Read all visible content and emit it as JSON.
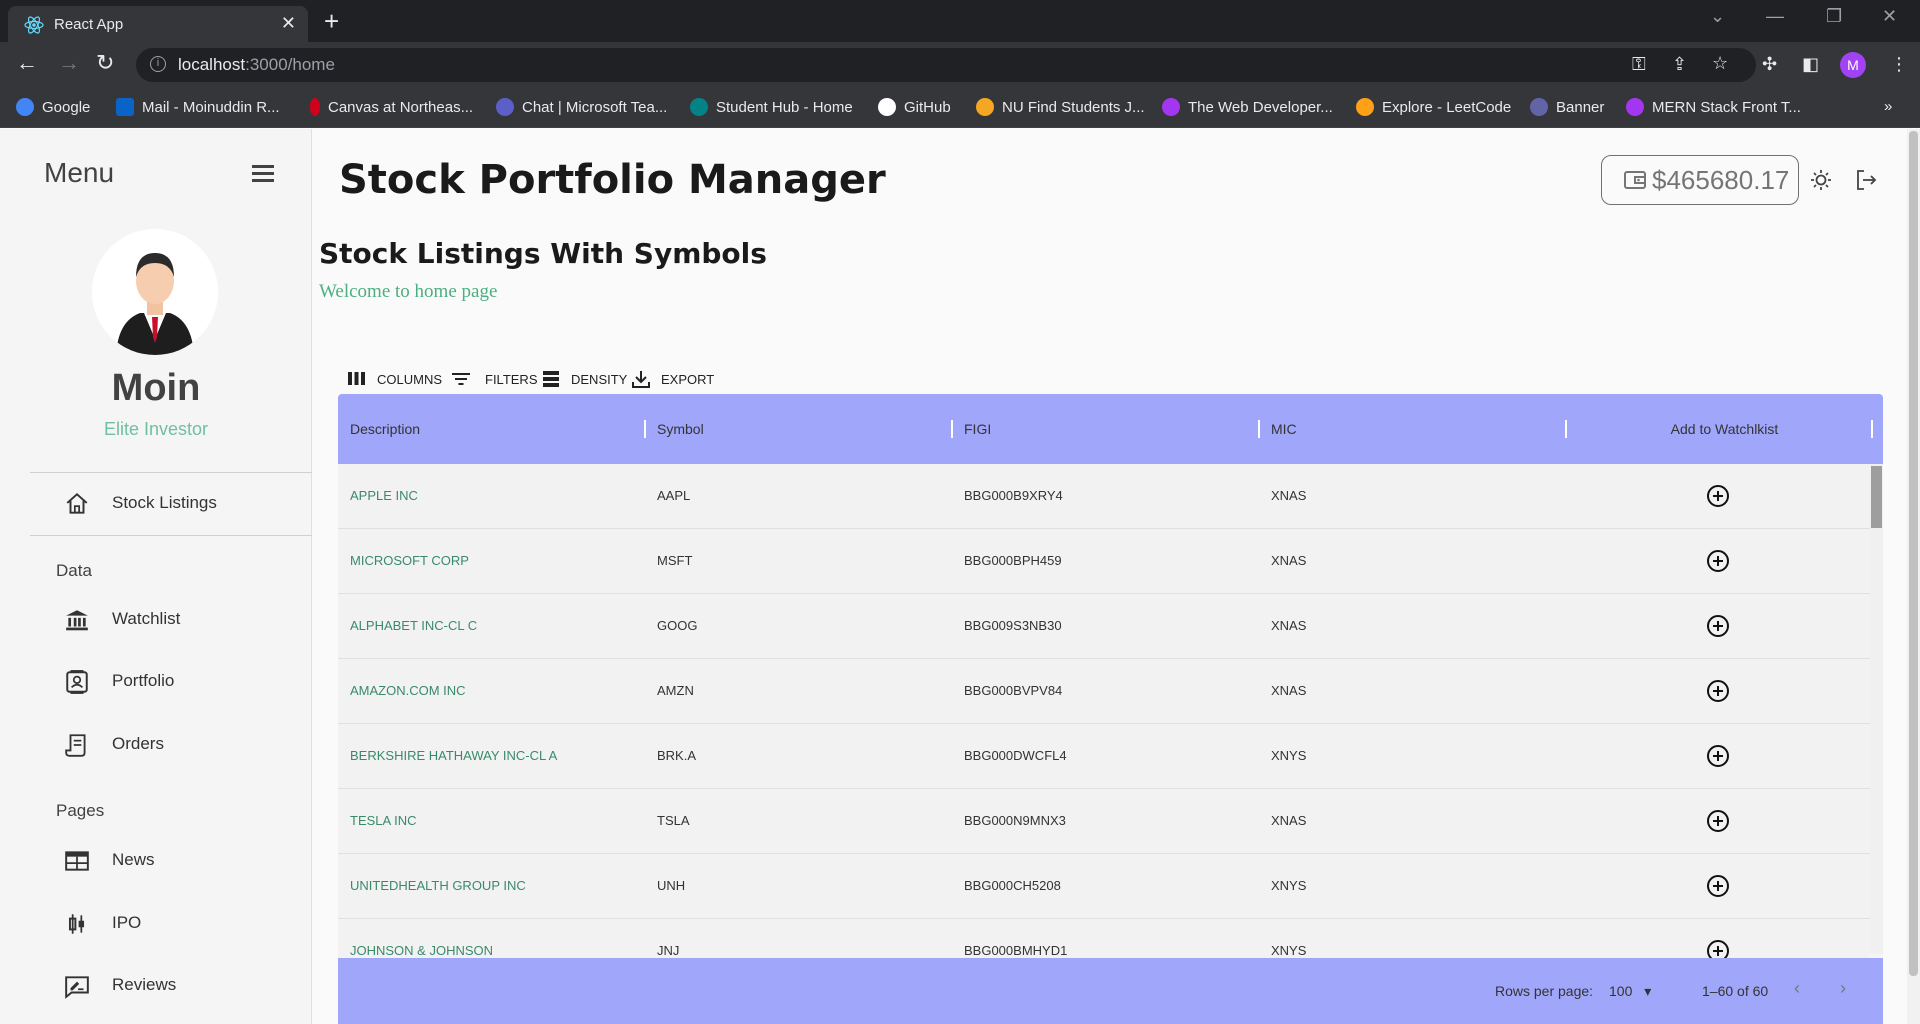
{
  "browser": {
    "tab_title": "React App",
    "url_host": "localhost",
    "url_rest": ":3000/home",
    "profile_initial": "M",
    "bookmarks": [
      {
        "label": "Google",
        "color": "#4285f4"
      },
      {
        "label": "Mail - Moinuddin R...",
        "color": "#0a64c8"
      },
      {
        "label": "Canvas at Northeas...",
        "color": "#d0021b"
      },
      {
        "label": "Chat | Microsoft Tea...",
        "color": "#5b5fc7"
      },
      {
        "label": "Student Hub - Home",
        "color": "#038387"
      },
      {
        "label": "GitHub",
        "color": "#ffffff"
      },
      {
        "label": "NU Find Students J...",
        "color": "#f5a623"
      },
      {
        "label": "The Web Developer...",
        "color": "#a435f0"
      },
      {
        "label": "Explore - LeetCode",
        "color": "#ffa116"
      },
      {
        "label": "Banner",
        "color": "#6264a7"
      },
      {
        "label": "MERN Stack Front T...",
        "color": "#a435f0"
      }
    ],
    "more_bookmarks": "»"
  },
  "sidebar": {
    "menu_title": "Menu",
    "user_name": "Moin",
    "user_role": "Elite Investor",
    "items": [
      {
        "label": "Stock Listings",
        "icon": "home-icon"
      },
      {
        "label": "Watchlist",
        "icon": "bank-icon"
      },
      {
        "label": "Portfolio",
        "icon": "contact-card-icon"
      },
      {
        "label": "Orders",
        "icon": "receipt-icon"
      },
      {
        "label": "News",
        "icon": "newspaper-icon"
      },
      {
        "label": "IPO",
        "icon": "candlestick-icon"
      },
      {
        "label": "Reviews",
        "icon": "rate-review-icon"
      }
    ],
    "sections": {
      "data": "Data",
      "pages": "Pages"
    }
  },
  "header": {
    "title": "Stock Portfolio Manager",
    "balance": "$465680.17"
  },
  "main": {
    "section_title": "Stock Listings With Symbols",
    "welcome": "Welcome to home page"
  },
  "grid_toolbar": {
    "columns": "COLUMNS",
    "filters": "FILTERS",
    "density": "DENSITY",
    "export": "EXPORT"
  },
  "table": {
    "columns": [
      "Description",
      "Symbol",
      "FIGI",
      "MIC",
      "Add to Watchlkist"
    ],
    "rows": [
      {
        "description": "APPLE INC",
        "symbol": "AAPL",
        "figi": "BBG000B9XRY4",
        "mic": "XNAS"
      },
      {
        "description": "MICROSOFT CORP",
        "symbol": "MSFT",
        "figi": "BBG000BPH459",
        "mic": "XNAS"
      },
      {
        "description": "ALPHABET INC-CL C",
        "symbol": "GOOG",
        "figi": "BBG009S3NB30",
        "mic": "XNAS"
      },
      {
        "description": "AMAZON.COM INC",
        "symbol": "AMZN",
        "figi": "BBG000BVPV84",
        "mic": "XNAS"
      },
      {
        "description": "BERKSHIRE HATHAWAY INC-CL A",
        "symbol": "BRK.A",
        "figi": "BBG000DWCFL4",
        "mic": "XNYS"
      },
      {
        "description": "TESLA INC",
        "symbol": "TSLA",
        "figi": "BBG000N9MNX3",
        "mic": "XNAS"
      },
      {
        "description": "UNITEDHEALTH GROUP INC",
        "symbol": "UNH",
        "figi": "BBG000CH5208",
        "mic": "XNYS"
      },
      {
        "description": "JOHNSON & JOHNSON",
        "symbol": "JNJ",
        "figi": "BBG000BMHYD1",
        "mic": "XNYS"
      }
    ]
  },
  "footer": {
    "rows_per_page_label": "Rows per page:",
    "rows_per_page_value": "100",
    "range": "1–60 of 60"
  },
  "colors": {
    "grid_header": "#a0a6fa",
    "accent_green": "#4caf80"
  }
}
